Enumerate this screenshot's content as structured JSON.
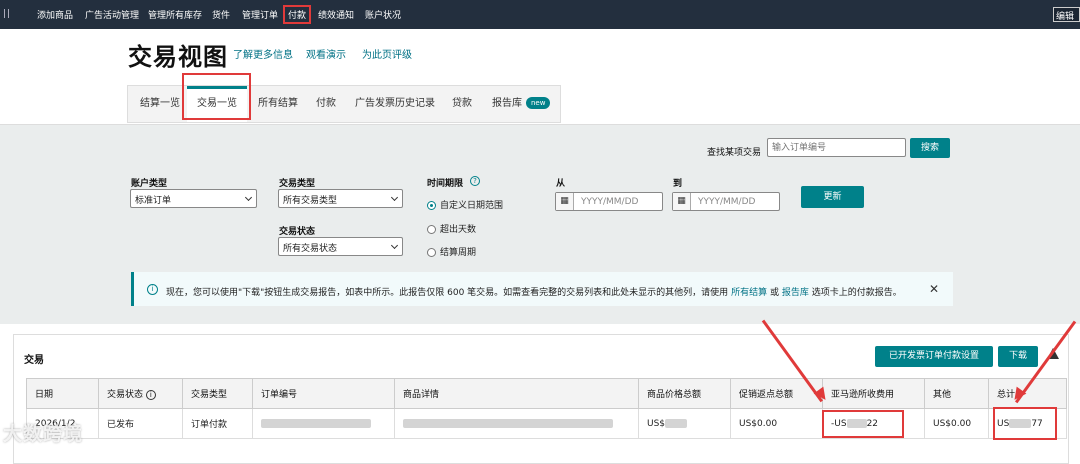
{
  "topnav": {
    "items": [
      "添加商品",
      "广告活动管理",
      "管理所有库存",
      "货件",
      "管理订单",
      "付款",
      "绩效通知",
      "账户状况"
    ],
    "edit_label": "编辑"
  },
  "header": {
    "title": "交易视图",
    "links": [
      "了解更多信息",
      "观看演示",
      "为此页评级"
    ]
  },
  "tabs": {
    "items": [
      "结算一览",
      "交易一览",
      "所有结算",
      "付款",
      "广告发票历史记录",
      "贷款",
      "报告库"
    ],
    "new_badge": "new"
  },
  "search": {
    "label": "查找某项交易",
    "placeholder": "输入订单编号",
    "button": "搜索"
  },
  "filters": {
    "account_type_label": "账户类型",
    "account_type_value": "标准订单",
    "tx_type_label": "交易类型",
    "tx_type_value": "所有交易类型",
    "tx_status_label": "交易状态",
    "tx_status_value": "所有交易状态",
    "time_label": "时间期限",
    "time_options": [
      "自定义日期范围",
      "超出天数",
      "结算周期"
    ],
    "from_label": "从",
    "to_label": "到",
    "date_placeholder": "YYYY/MM/DD",
    "update_button": "更新"
  },
  "info": {
    "text_a": "现在，您可以使用\"下载\"按钮生成交易报告，如表中所示。此报告仅限 600 笔交易。如需查看完整的交易列表和此处未显示的其他列，请使用",
    "link1": "所有结算",
    "text_b": "或",
    "link2": "报告库",
    "text_c": "选项卡上的付款报告。"
  },
  "card": {
    "title": "交易",
    "settings_button": "已开发票订单付款设置",
    "download_button": "下载"
  },
  "table": {
    "headers": [
      "日期",
      "交易状态",
      "交易类型",
      "订单编号",
      "商品详情",
      "商品价格总额",
      "促销返点总额",
      "亚马逊所收费用",
      "其他",
      "总计"
    ],
    "row": {
      "date": "2026/1/2",
      "status": "已发布",
      "type": "订单付款",
      "price": "US$",
      "promo": "US$0.00",
      "fee_prefix": "-US",
      "fee_suffix": "22",
      "other": "US$0.00",
      "total_prefix": "US",
      "total_suffix": "77"
    }
  },
  "watermark": "大数跨境",
  "colors": {
    "teal": "#00818a",
    "nav": "#232f3e",
    "highlight": "#e03a3a"
  }
}
